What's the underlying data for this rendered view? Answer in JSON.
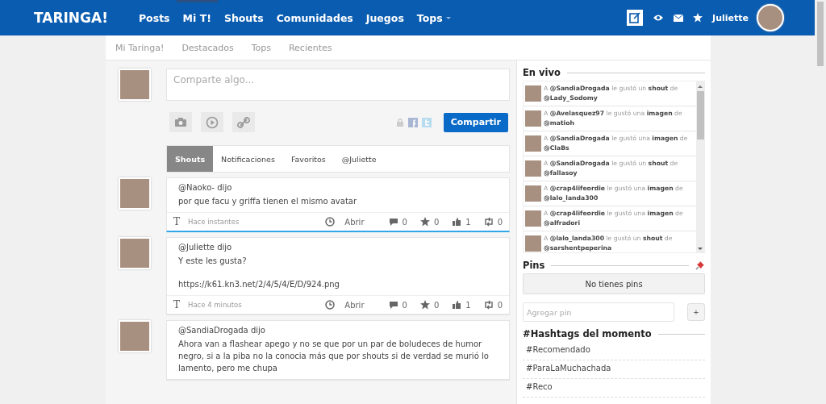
{
  "header": {
    "logo": "TARINGA!",
    "nav": [
      {
        "label": "Posts",
        "selected": false,
        "dropdown": false
      },
      {
        "label": "Mi T!",
        "selected": true,
        "dropdown": false
      },
      {
        "label": "Shouts",
        "selected": false,
        "dropdown": false
      },
      {
        "label": "Comunidades",
        "selected": false,
        "dropdown": false
      },
      {
        "label": "Juegos",
        "selected": false,
        "dropdown": false
      },
      {
        "label": "Tops",
        "selected": false,
        "dropdown": true
      }
    ],
    "username": "Juliette"
  },
  "subnav": [
    "Mi Taringa!",
    "Destacados",
    "Tops",
    "Recientes"
  ],
  "composer": {
    "placeholder": "Comparte algo...",
    "button": "Compartir"
  },
  "tabs": [
    {
      "label": "Shouts",
      "selected": true
    },
    {
      "label": "Notificaciones",
      "selected": false
    },
    {
      "label": "Favoritos",
      "selected": false
    },
    {
      "label": "@Juliette",
      "selected": false
    }
  ],
  "posts": [
    {
      "author": "@Naoko- dijo",
      "lines": [
        "por que facu y griffa tienen el mismo avatar"
      ],
      "format_icon": "T",
      "time": "Hace instantes",
      "open": "Abrir",
      "comments": "0",
      "favorites": "0",
      "likes": "1",
      "reshares": "0",
      "highlighted": true
    },
    {
      "author": "@Juliette dijo",
      "lines": [
        "Y este les gusta?",
        "https://k61.kn3.net/2/4/5/4/E/D/924.png"
      ],
      "format_icon": "T",
      "time": "Hace 4 minutos",
      "open": "Abrir",
      "comments": "0",
      "favorites": "0",
      "likes": "1",
      "reshares": "0",
      "highlighted": false
    },
    {
      "author": "@SandiaDrogada dijo",
      "lines": [
        "Ahora van a flashear apego y no se que por un par de boludeces de humor negro, si a la piba no la conocia más que por shouts si de verdad se murió lo lamento, pero me chupa"
      ]
    }
  ],
  "live": {
    "title": "En vivo",
    "items": [
      {
        "text": "A **@SandiaDrogada** le gustó un **shout** de **@Lady_Sodomy**"
      },
      {
        "text": "A **@Avelasquez97** le gustó una **imagen** de **@matioh**"
      },
      {
        "text": "A **@SandiaDrogada** le gustó una **imagen** de **@ClaBs**"
      },
      {
        "text": "A **@SandiaDrogada** le gustó un **shout** de **@fallasoy**"
      },
      {
        "text": "A **@crap4lifeordie** le gustó una **imagen** de **@lalo_landa300**"
      },
      {
        "text": "A **@crap4lifeordie** le gustó una **imagen** de **@alfradori**"
      },
      {
        "text": "A **@lalo_landa300** le gustó un **shout** de **@sarshentpeperina**"
      }
    ]
  },
  "pins": {
    "title": "Pins",
    "empty": "No tienes pins",
    "placeholder": "Agregar pin",
    "add": "+"
  },
  "hashtags": {
    "title": "#Hashtags del momento",
    "items": [
      "#Recomendado",
      "#ParaLaMuchachada",
      "#Reco"
    ]
  }
}
